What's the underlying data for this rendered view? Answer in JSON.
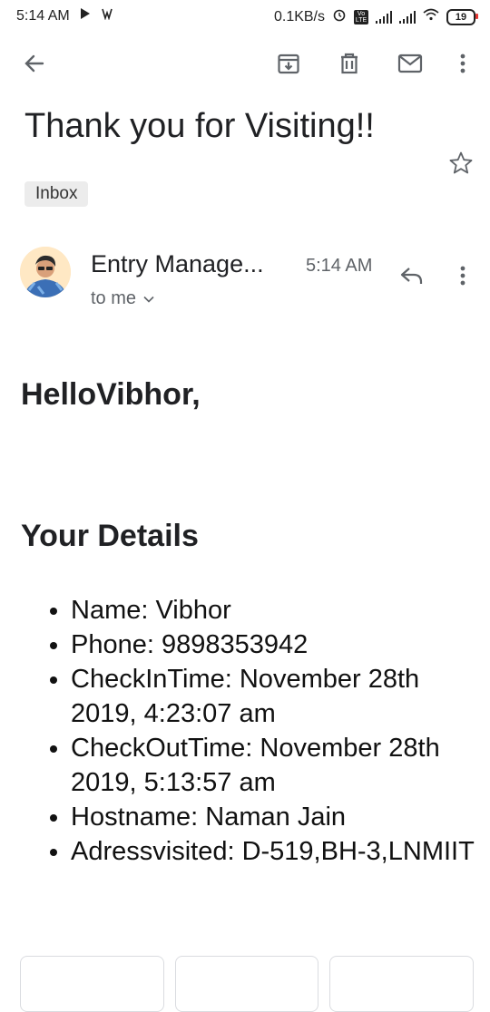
{
  "status_bar": {
    "time": "5:14 AM",
    "net_speed": "0.1KB/s",
    "volte": "Vo LTE",
    "battery": "19"
  },
  "email": {
    "subject": "Thank you for Visiting!!",
    "label": "Inbox",
    "sender": "Entry Manage...",
    "time": "5:14 AM",
    "recipient": "to me",
    "greeting": "HelloVibhor,",
    "section_title": "Your Details",
    "details": [
      "Name: Vibhor",
      "Phone: 9898353942",
      "CheckInTime: November 28th 2019, 4:23:07 am",
      "CheckOutTime: November 28th 2019, 5:13:57 am",
      "Hostname: Naman Jain",
      "Adressvisited: D-519,BH-3,LNMIIT"
    ]
  },
  "icons": {
    "back": "arrow-left-icon",
    "archive": "archive-icon",
    "delete": "trash-icon",
    "mark_unread": "mail-icon",
    "more": "more-vertical-icon",
    "star": "star-icon",
    "reply": "reply-icon"
  },
  "colors": {
    "battery_accent": "#e53935",
    "chip_bg": "#ececec"
  }
}
